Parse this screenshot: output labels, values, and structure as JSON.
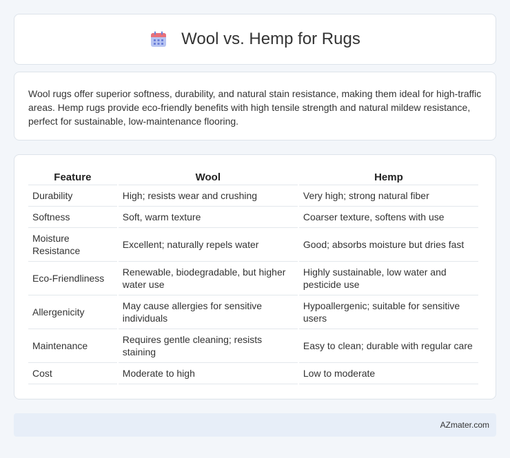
{
  "header": {
    "title": "Wool vs. Hemp for Rugs",
    "icon": "calendar-icon",
    "icon_colors": {
      "body": "#a9b9f0",
      "top": "#e8707a",
      "dots": "#6b7fd8"
    }
  },
  "intro": {
    "text": "Wool rugs offer superior softness, durability, and natural stain resistance, making them ideal for high-traffic areas. Hemp rugs provide eco-friendly benefits with high tensile strength and natural mildew resistance, perfect for sustainable, low-maintenance flooring."
  },
  "table": {
    "headers": [
      "Feature",
      "Wool",
      "Hemp"
    ],
    "rows": [
      [
        "Durability",
        "High; resists wear and crushing",
        "Very high; strong natural fiber"
      ],
      [
        "Softness",
        "Soft, warm texture",
        "Coarser texture, softens with use"
      ],
      [
        "Moisture Resistance",
        "Excellent; naturally repels water",
        "Good; absorbs moisture but dries fast"
      ],
      [
        "Eco-Friendliness",
        "Renewable, biodegradable, but higher water use",
        "Highly sustainable, low water and pesticide use"
      ],
      [
        "Allergenicity",
        "May cause allergies for sensitive individuals",
        "Hypoallergenic; suitable for sensitive users"
      ],
      [
        "Maintenance",
        "Requires gentle cleaning; resists staining",
        "Easy to clean; durable with regular care"
      ],
      [
        "Cost",
        "Moderate to high",
        "Low to moderate"
      ]
    ]
  },
  "footer": {
    "text": "AZmater.com"
  }
}
